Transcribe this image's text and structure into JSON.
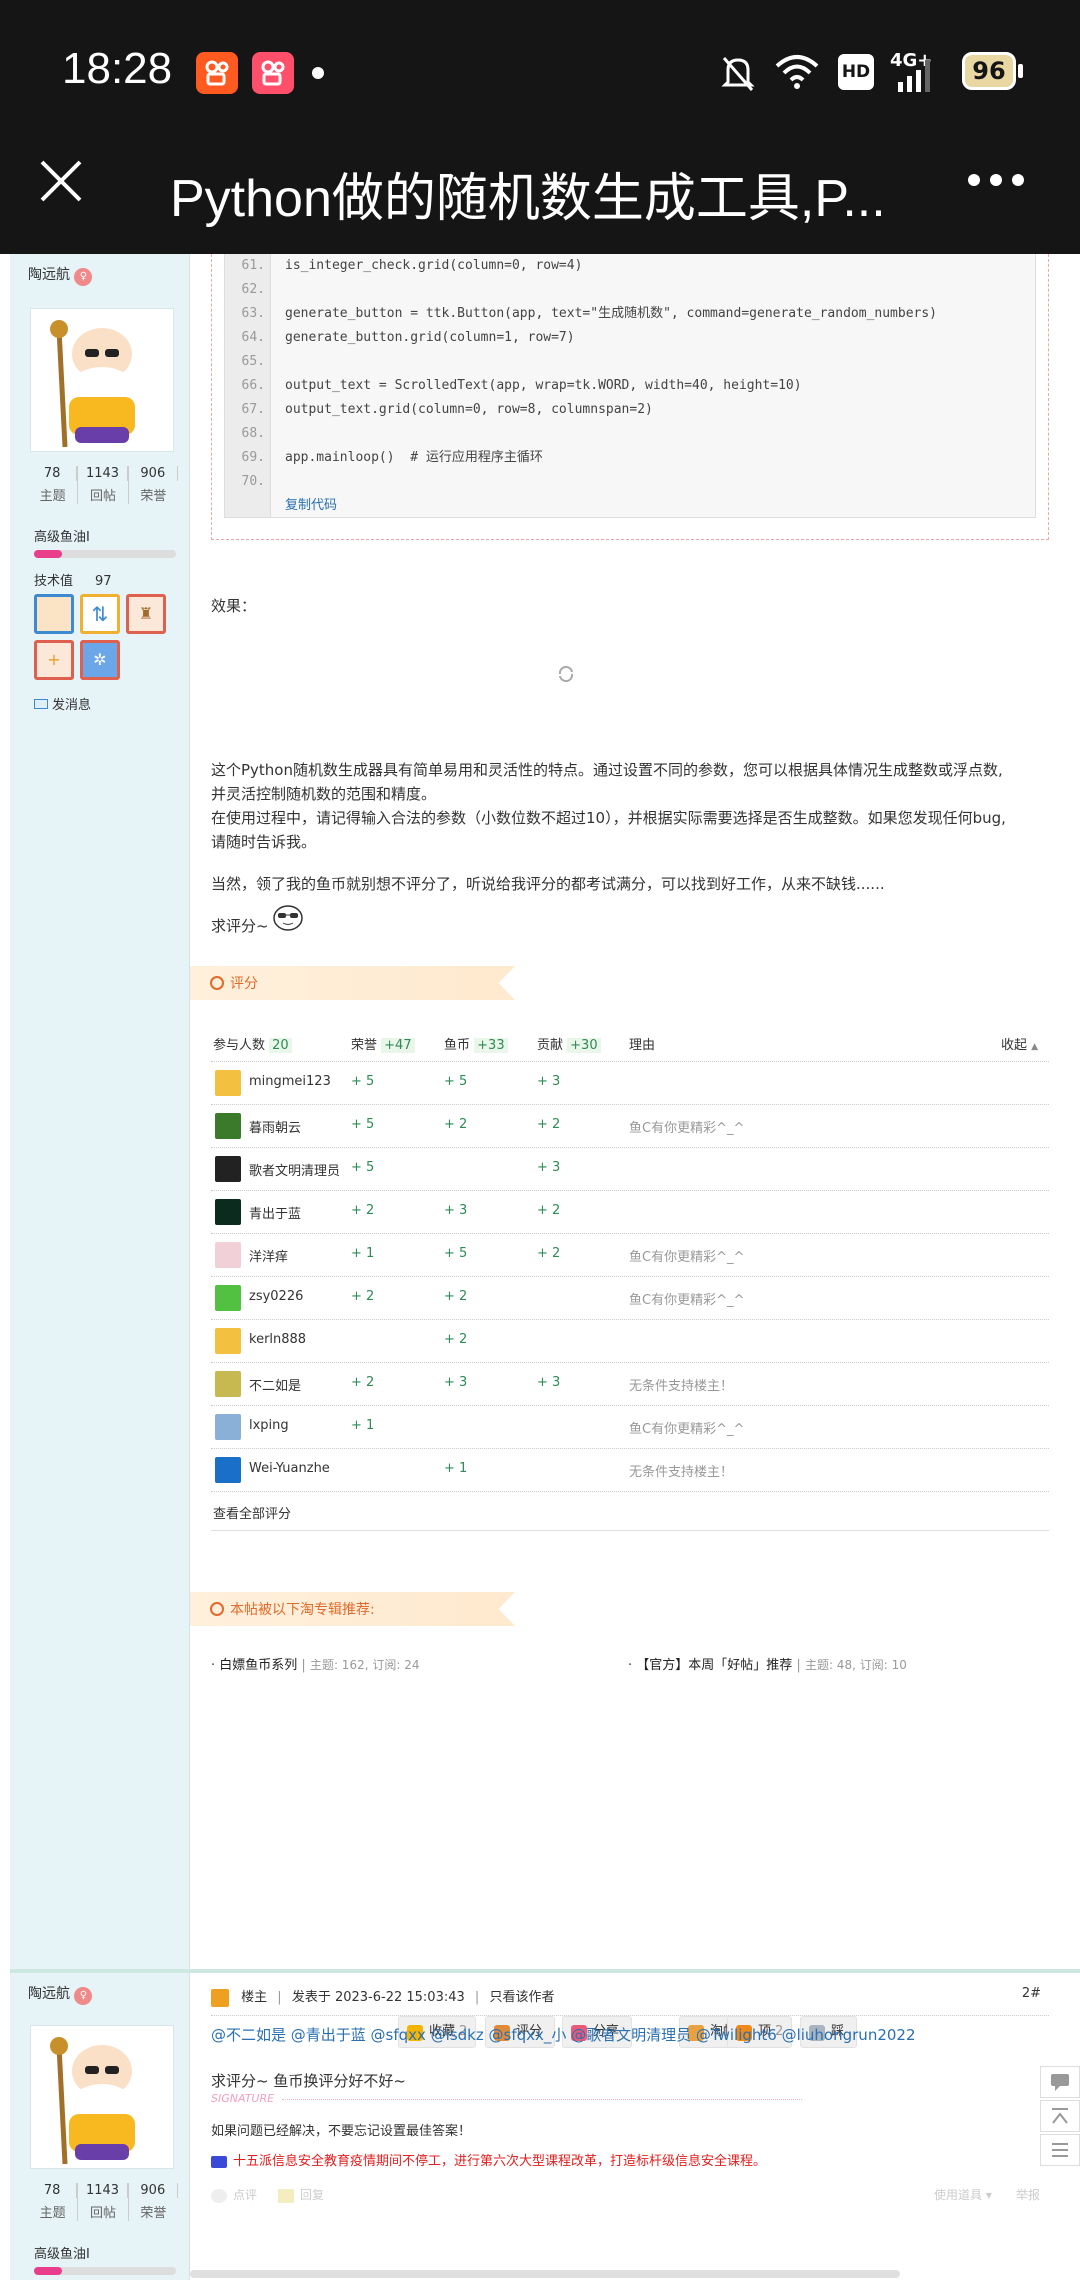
{
  "status_bar": {
    "time": "18:28",
    "network": "HD",
    "signal": "4G+",
    "battery": "96"
  },
  "title_bar": {
    "title": "Python做的随机数生成工具,P..."
  },
  "sidebar": {
    "name": "陶远航",
    "stats": [
      {
        "value": "78",
        "label": "主题"
      },
      {
        "value": "1143",
        "label": "回帖"
      },
      {
        "value": "906",
        "label": "荣誉"
      }
    ],
    "rank": "高级鱼油I",
    "tech_label": "技术值",
    "tech_value": "97",
    "message": "发消息"
  },
  "code": {
    "lines": [
      {
        "n": "61.",
        "t": "is_integer_check.grid(column=0, row=4)"
      },
      {
        "n": "62.",
        "t": ""
      },
      {
        "n": "63.",
        "t": "generate_button = ttk.Button(app, text=\"生成随机数\", command=generate_random_numbers)"
      },
      {
        "n": "64.",
        "t": "generate_button.grid(column=1, row=7)"
      },
      {
        "n": "65.",
        "t": ""
      },
      {
        "n": "66.",
        "t": "output_text = ScrolledText(app, wrap=tk.WORD, width=40, height=10)"
      },
      {
        "n": "67.",
        "t": "output_text.grid(column=0, row=8, columnspan=2)"
      },
      {
        "n": "68.",
        "t": ""
      },
      {
        "n": "69.",
        "t": "app.mainloop()  # 运行应用程序主循环"
      },
      {
        "n": "70.",
        "t": ""
      }
    ],
    "copy": "复制代码"
  },
  "post": {
    "effect": "效果：",
    "p1a": "这个Python随机数生成器具有简单易用和灵活性的特点。通过设置不同的参数，您可以根据具体情况生成整数或浮点数,",
    "p1b": "并灵活控制随机数的范围和精度。",
    "p2a": "在使用过程中，请记得输入合法的参数（小数位数不超过10），并根据实际需要选择是否生成整数。如果您发现任何bug,",
    "p2b": "请随时告诉我。",
    "p3": "当然，领了我的鱼币就别想不评分了，听说给我评分的都考试满分，可以找到好工作，从来不缺钱......",
    "p4": "求评分~"
  },
  "rating": {
    "title": "评分",
    "headers": {
      "people": "参与人数",
      "people_n": "20",
      "honor": "荣誉",
      "honor_n": "+47",
      "coin": "鱼币",
      "coin_n": "+33",
      "contrib": "贡献",
      "contrib_n": "+30",
      "reason": "理由",
      "collapse": "收起"
    },
    "rows": [
      {
        "user": "mingmei123",
        "honor": "+ 5",
        "coin": "+ 5",
        "contrib": "+ 3",
        "reason": ""
      },
      {
        "user": "暮雨朝云",
        "honor": "+ 5",
        "coin": "+ 2",
        "contrib": "+ 2",
        "reason": "鱼C有你更精彩^_^"
      },
      {
        "user": "歌者文明清理员",
        "honor": "+ 5",
        "coin": "",
        "contrib": "+ 3",
        "reason": ""
      },
      {
        "user": "青出于蓝",
        "honor": "+ 2",
        "coin": "+ 3",
        "contrib": "+ 2",
        "reason": ""
      },
      {
        "user": "洋洋痒",
        "honor": "+ 1",
        "coin": "+ 5",
        "contrib": "+ 2",
        "reason": "鱼C有你更精彩^_^"
      },
      {
        "user": "zsy0226",
        "honor": "+ 2",
        "coin": "+ 2",
        "contrib": "",
        "reason": "鱼C有你更精彩^_^"
      },
      {
        "user": "kerln888",
        "honor": "",
        "coin": "+ 2",
        "contrib": "",
        "reason": ""
      },
      {
        "user": "不二如是",
        "honor": "+ 2",
        "coin": "+ 3",
        "contrib": "+ 3",
        "reason": "无条件支持楼主！"
      },
      {
        "user": "lxping",
        "honor": "+ 1",
        "coin": "",
        "contrib": "",
        "reason": "鱼C有你更精彩^_^"
      },
      {
        "user": "Wei-Yuanzhe",
        "honor": "",
        "coin": "+ 1",
        "contrib": "",
        "reason": "无条件支持楼主！"
      }
    ],
    "view_all": "查看全部评分"
  },
  "recommend": {
    "title": "本帖被以下淘专辑推荐:",
    "items": [
      {
        "name": "白嫖鱼币系列",
        "meta": "主题: 162, 订阅: 24"
      },
      {
        "name": "【官方】本周「好帖」推荐",
        "meta": "主题: 48, 订阅: 10"
      }
    ]
  },
  "actions": [
    {
      "label": "收藏",
      "count": "2",
      "color": "#f5b400"
    },
    {
      "label": "评分",
      "count": "",
      "color": "#e08a3c"
    },
    {
      "label": "分享",
      "count": "",
      "color": "#e85a7a"
    },
    {
      "label": "淘帖",
      "count": "2",
      "color": "#e8a040"
    },
    {
      "label": "顶",
      "count": "2",
      "color": "#ef8a1a"
    },
    {
      "label": "踩",
      "count": "",
      "color": "#a8b4c0"
    }
  ],
  "signature": {
    "label": "SIGNATURE",
    "line1": "如果问题已经解决，不要忘记设置最佳答案！",
    "line2": "十五派信息安全教育疫情期间不停工，进行第六次大型课程改革，打造标杆级信息安全课程。"
  },
  "post_footer": {
    "rate": "点评",
    "reply": "回复",
    "tools": "使用道具",
    "report": "举报"
  },
  "post2": {
    "floor": "楼主",
    "posted": "发表于 2023-6-22 15:03:43",
    "only_author": "只看该作者",
    "number": "2#",
    "mentions": "@不二如是 @青出于蓝 @sfqxx @isdkz @sfqxx_小 @歌者文明清理员 @Twilight6 @liuhongrun2022",
    "text": "求评分~ 鱼币换评分好不好~"
  },
  "colors": {
    "bar": "#151515",
    "sidebar": "#e6f3f7",
    "link": "#2a6fb0",
    "green": "#2e8b57",
    "orange": "#e06a2b",
    "red": "#e02020"
  }
}
